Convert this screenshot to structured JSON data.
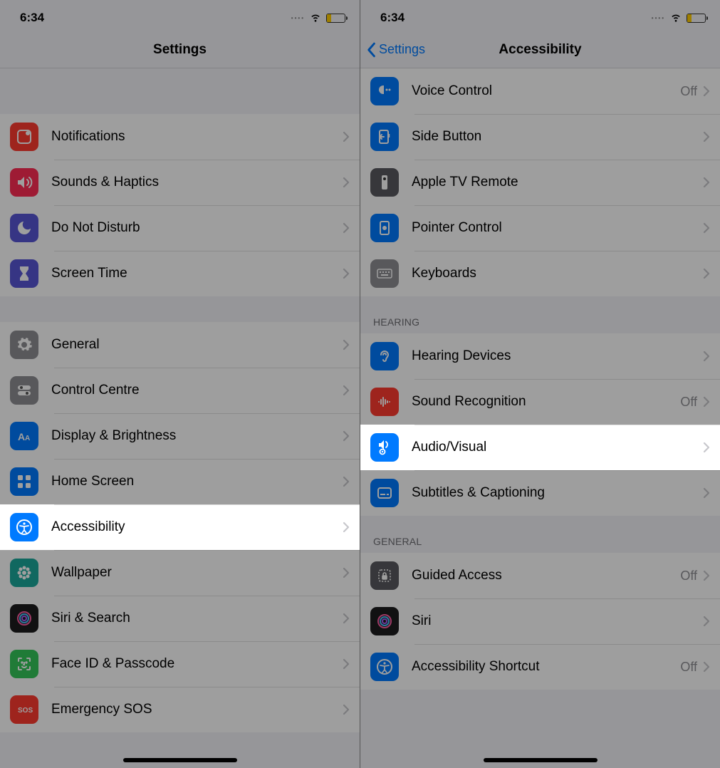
{
  "status": {
    "time": "6:34"
  },
  "left": {
    "title": "Settings",
    "groups": [
      {
        "rows": [
          {
            "label": "Notifications",
            "icon": "notifications",
            "bg": "ic-red"
          },
          {
            "label": "Sounds & Haptics",
            "icon": "sounds",
            "bg": "ic-pink"
          },
          {
            "label": "Do Not Disturb",
            "icon": "moon",
            "bg": "ic-purple"
          },
          {
            "label": "Screen Time",
            "icon": "hourglass",
            "bg": "ic-purple"
          }
        ]
      },
      {
        "rows": [
          {
            "label": "General",
            "icon": "gear",
            "bg": "ic-gray"
          },
          {
            "label": "Control Centre",
            "icon": "switches",
            "bg": "ic-gray"
          },
          {
            "label": "Display & Brightness",
            "icon": "text-size",
            "bg": "ic-blue"
          },
          {
            "label": "Home Screen",
            "icon": "grid",
            "bg": "ic-blue"
          },
          {
            "label": "Accessibility",
            "icon": "accessibility",
            "bg": "ic-blue",
            "highlight": true
          },
          {
            "label": "Wallpaper",
            "icon": "flower",
            "bg": "ic-teal"
          },
          {
            "label": "Siri & Search",
            "icon": "siri",
            "bg": "ic-dark"
          },
          {
            "label": "Face ID & Passcode",
            "icon": "faceid",
            "bg": "ic-green"
          },
          {
            "label": "Emergency SOS",
            "icon": "sos",
            "bg": "ic-red"
          }
        ]
      }
    ]
  },
  "right": {
    "back": "Settings",
    "title": "Accessibility",
    "groups": [
      {
        "rows": [
          {
            "label": "Voice Control",
            "icon": "voice",
            "bg": "ic-blue",
            "value": "Off"
          },
          {
            "label": "Side Button",
            "icon": "side-button",
            "bg": "ic-blue"
          },
          {
            "label": "Apple TV Remote",
            "icon": "remote",
            "bg": "ic-darkgray"
          },
          {
            "label": "Pointer Control",
            "icon": "pointer",
            "bg": "ic-blue"
          },
          {
            "label": "Keyboards",
            "icon": "keyboard",
            "bg": "ic-gray"
          }
        ]
      },
      {
        "header": "HEARING",
        "rows": [
          {
            "label": "Hearing Devices",
            "icon": "ear",
            "bg": "ic-blue"
          },
          {
            "label": "Sound Recognition",
            "icon": "waveform",
            "bg": "ic-red",
            "value": "Off"
          },
          {
            "label": "Audio/Visual",
            "icon": "audio-visual",
            "bg": "ic-blue",
            "highlight": true
          },
          {
            "label": "Subtitles & Captioning",
            "icon": "captions",
            "bg": "ic-blue"
          }
        ]
      },
      {
        "header": "GENERAL",
        "rows": [
          {
            "label": "Guided Access",
            "icon": "lock",
            "bg": "ic-darkgray",
            "value": "Off"
          },
          {
            "label": "Siri",
            "icon": "siri",
            "bg": "ic-dark"
          },
          {
            "label": "Accessibility Shortcut",
            "icon": "accessibility",
            "bg": "ic-blue",
            "value": "Off"
          }
        ]
      }
    ]
  }
}
